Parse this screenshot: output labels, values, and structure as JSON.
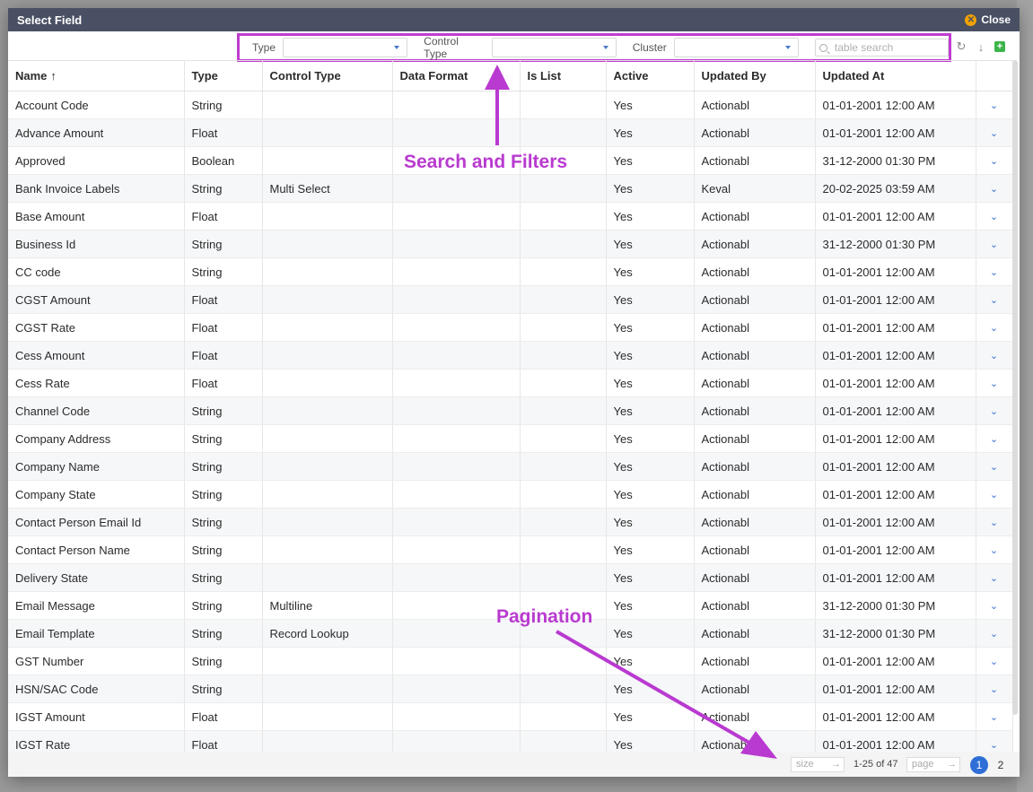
{
  "modal": {
    "title": "Select Field",
    "close_label": "Close"
  },
  "filters": {
    "type_label": "Type",
    "control_type_label": "Control Type",
    "cluster_label": "Cluster",
    "search_placeholder": "table search"
  },
  "columns": [
    "Name",
    "Type",
    "Control Type",
    "Data Format",
    "Is List",
    "Active",
    "Updated By",
    "Updated At"
  ],
  "rows": [
    [
      "Account Code",
      "String",
      "",
      "",
      "",
      "Yes",
      "Actionabl",
      "01-01-2001 12:00 AM"
    ],
    [
      "Advance Amount",
      "Float",
      "",
      "",
      "",
      "Yes",
      "Actionabl",
      "01-01-2001 12:00 AM"
    ],
    [
      "Approved",
      "Boolean",
      "",
      "",
      "",
      "Yes",
      "Actionabl",
      "31-12-2000 01:30 PM"
    ],
    [
      "Bank Invoice Labels",
      "String",
      "Multi Select",
      "",
      "",
      "Yes",
      "Keval",
      "20-02-2025 03:59 AM"
    ],
    [
      "Base Amount",
      "Float",
      "",
      "",
      "",
      "Yes",
      "Actionabl",
      "01-01-2001 12:00 AM"
    ],
    [
      "Business Id",
      "String",
      "",
      "",
      "",
      "Yes",
      "Actionabl",
      "31-12-2000 01:30 PM"
    ],
    [
      "CC code",
      "String",
      "",
      "",
      "",
      "Yes",
      "Actionabl",
      "01-01-2001 12:00 AM"
    ],
    [
      "CGST Amount",
      "Float",
      "",
      "",
      "",
      "Yes",
      "Actionabl",
      "01-01-2001 12:00 AM"
    ],
    [
      "CGST Rate",
      "Float",
      "",
      "",
      "",
      "Yes",
      "Actionabl",
      "01-01-2001 12:00 AM"
    ],
    [
      "Cess Amount",
      "Float",
      "",
      "",
      "",
      "Yes",
      "Actionabl",
      "01-01-2001 12:00 AM"
    ],
    [
      "Cess Rate",
      "Float",
      "",
      "",
      "",
      "Yes",
      "Actionabl",
      "01-01-2001 12:00 AM"
    ],
    [
      "Channel Code",
      "String",
      "",
      "",
      "",
      "Yes",
      "Actionabl",
      "01-01-2001 12:00 AM"
    ],
    [
      "Company Address",
      "String",
      "",
      "",
      "",
      "Yes",
      "Actionabl",
      "01-01-2001 12:00 AM"
    ],
    [
      "Company Name",
      "String",
      "",
      "",
      "",
      "Yes",
      "Actionabl",
      "01-01-2001 12:00 AM"
    ],
    [
      "Company State",
      "String",
      "",
      "",
      "",
      "Yes",
      "Actionabl",
      "01-01-2001 12:00 AM"
    ],
    [
      "Contact Person Email Id",
      "String",
      "",
      "",
      "",
      "Yes",
      "Actionabl",
      "01-01-2001 12:00 AM"
    ],
    [
      "Contact Person Name",
      "String",
      "",
      "",
      "",
      "Yes",
      "Actionabl",
      "01-01-2001 12:00 AM"
    ],
    [
      "Delivery State",
      "String",
      "",
      "",
      "",
      "Yes",
      "Actionabl",
      "01-01-2001 12:00 AM"
    ],
    [
      "Email Message",
      "String",
      "Multiline",
      "",
      "",
      "Yes",
      "Actionabl",
      "31-12-2000 01:30 PM"
    ],
    [
      "Email Template",
      "String",
      "Record Lookup",
      "",
      "",
      "Yes",
      "Actionabl",
      "31-12-2000 01:30 PM"
    ],
    [
      "GST Number",
      "String",
      "",
      "",
      "",
      "Yes",
      "Actionabl",
      "01-01-2001 12:00 AM"
    ],
    [
      "HSN/SAC Code",
      "String",
      "",
      "",
      "",
      "Yes",
      "Actionabl",
      "01-01-2001 12:00 AM"
    ],
    [
      "IGST Amount",
      "Float",
      "",
      "",
      "",
      "Yes",
      "Actionabl",
      "01-01-2001 12:00 AM"
    ],
    [
      "IGST Rate",
      "Float",
      "",
      "",
      "",
      "Yes",
      "Actionabl",
      "01-01-2001 12:00 AM"
    ]
  ],
  "pagination": {
    "size_placeholder": "size",
    "range": "1-25 of 47",
    "page_placeholder": "page",
    "current": "1",
    "next": "2"
  },
  "annotations": {
    "search_filters": "Search and Filters",
    "pagination": "Pagination"
  },
  "colors": {
    "header_bg": "#4a5064",
    "annotation": "#b93ad0",
    "accent": "#2f6ed7"
  }
}
